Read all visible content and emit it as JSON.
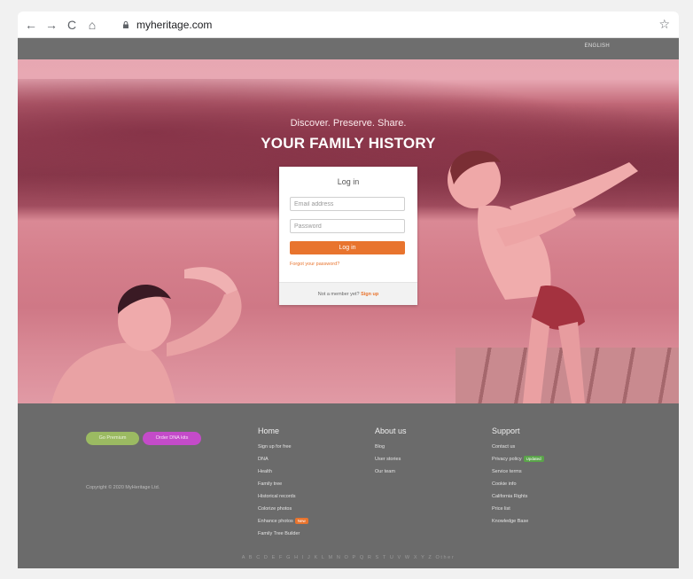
{
  "browser": {
    "url": "myheritage.com",
    "back_icon": "←",
    "forward_icon": "→",
    "reload_icon": "C",
    "home_icon": "⌂",
    "star_icon": "☆"
  },
  "topbar": {
    "language": "ENGLISH"
  },
  "hero": {
    "tagline": "Discover. Preserve. Share.",
    "headline": "YOUR FAMILY HISTORY"
  },
  "login": {
    "title": "Log in",
    "email_placeholder": "Email address",
    "password_placeholder": "Password",
    "button_label": "Log in",
    "forgot_link": "Forgot your password?",
    "not_member_text": "Not a member yet?",
    "signup_link": "Sign up"
  },
  "footer": {
    "premium_button": "Go Premium",
    "dna_button": "Order DNA kits",
    "copyright": "Copyright © 2020 MyHeritage Ltd.",
    "home": {
      "title": "Home",
      "links": [
        "Sign up for free",
        "DNA",
        "Health",
        "Family tree",
        "Historical records",
        "Colorize photos",
        "Enhance photos",
        "Family Tree Builder"
      ],
      "new_badge": "New"
    },
    "about": {
      "title": "About us",
      "links": [
        "Blog",
        "User stories",
        "Our team"
      ]
    },
    "support": {
      "title": "Support",
      "links": [
        "Contact us",
        "Privacy policy",
        "Service terms",
        "Cookie info",
        "California Rights",
        "Price list",
        "Knowledge Base"
      ],
      "updated_badge": "Updated"
    },
    "alphabet": "A B C D E F G H I  J  K L M N O P Q R S T U V W X Y Z Other"
  },
  "colors": {
    "accent_orange": "#e8742e",
    "premium_green": "#9bba62",
    "dna_purple": "#c44bc9",
    "footer_gray": "#6b6b6b"
  }
}
